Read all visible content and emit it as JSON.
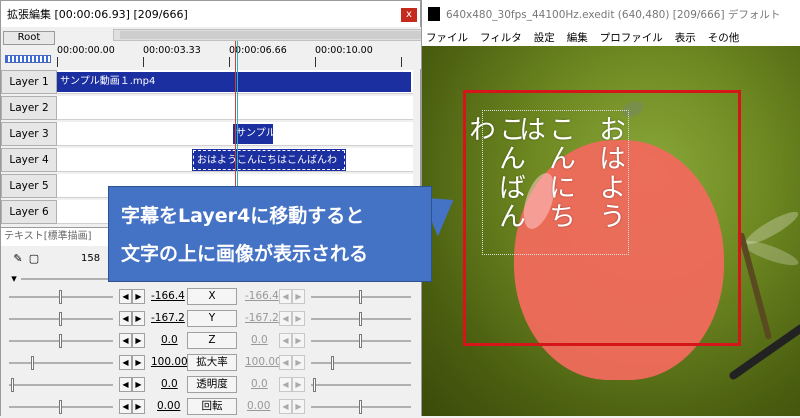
{
  "timeline": {
    "title": "拡張編集 [00:00:06.93] [209/666]",
    "close_label": "x",
    "root_label": "Root",
    "ruler_labels": [
      "00:00:00.00",
      "00:00:03.33",
      "00:00:06.66",
      "00:00:10.00"
    ],
    "layers": [
      {
        "label": "Layer 1",
        "clip": "サンプル動画１.mp4"
      },
      {
        "label": "Layer 2",
        "clip": ""
      },
      {
        "label": "Layer 3",
        "clip": "サンプル画"
      },
      {
        "label": "Layer 4",
        "clip": "おはようこんにちはこんばんわ"
      },
      {
        "label": "Layer 5",
        "clip": ""
      },
      {
        "label": "Layer 6",
        "clip": ""
      }
    ]
  },
  "settings": {
    "title": "テキスト[標準描画]",
    "frame": "158",
    "params": [
      {
        "name": "X",
        "start": "-166.4",
        "end": "-166.4"
      },
      {
        "name": "Y",
        "start": "-167.2",
        "end": "-167.2"
      },
      {
        "name": "Z",
        "start": "0.0",
        "end": "0.0"
      },
      {
        "name": "拡大率",
        "start": "100.00",
        "end": "100.00"
      },
      {
        "name": "透明度",
        "start": "0.0",
        "end": "0.0"
      },
      {
        "name": "回転",
        "start": "0.00",
        "end": "0.00"
      }
    ]
  },
  "preview": {
    "title": "640x480_30fps_44100Hz.exedit (640,480)  [209/666]  デフォルト",
    "menu": [
      "ファイル",
      "フィルタ",
      "設定",
      "編集",
      "プロファイル",
      "表示",
      "その他"
    ],
    "text_lines": [
      "おはよう",
      "こんにちは",
      "こんばんわ"
    ]
  },
  "callout": {
    "line1": "字幕をLayer4に移動すると",
    "line2": "文字の上に画像が表示される"
  },
  "colors": {
    "clip": "#1b2fa0",
    "callout": "#4472c4",
    "highlight_frame": "#d4151a",
    "apple": "#f06a5c"
  }
}
